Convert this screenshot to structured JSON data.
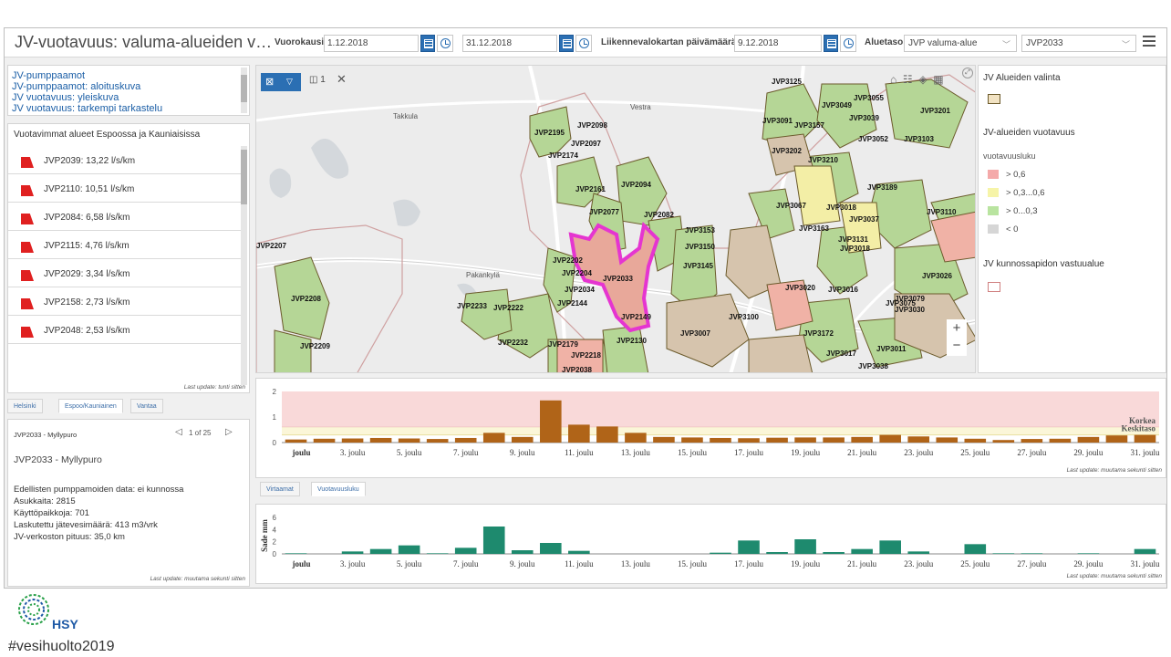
{
  "header": {
    "title": "JV-vuotavuus: valuma-alueiden v…",
    "period_label": "Vuorokausi",
    "start_date": "1.12.2018",
    "end_date": "31.12.2018",
    "trafficmap_label": "Liikennevalokartan päivämäärä",
    "trafficmap_date": "9.12.2018",
    "area_label": "Aluetaso",
    "area_level": "JVP valuma-alue",
    "area_id": "JVP2033"
  },
  "links": [
    "JV-pumppaamot",
    "JV-pumppaamot: aloituskuva",
    "JV vuotavuus: yleiskuva",
    "JV vuotavuus: tarkempi tarkastelu"
  ],
  "ranking": {
    "title": "Vuotavimmat alueet Espoossa ja Kauniaisissa",
    "items": [
      "JVP2039: 13,22 l/s/km",
      "JVP2110: 10,51 l/s/km",
      "JVP2084: 6,58 l/s/km",
      "JVP2115: 4,76 l/s/km",
      "JVP2029: 3,34 l/s/km",
      "JVP2158: 2,73 l/s/km",
      "JVP2048: 2,53 l/s/km"
    ],
    "last_update": "Last update: tunti sitten",
    "tabs": [
      "Helsinki",
      "Espoo/Kauniainen",
      "Vantaa"
    ]
  },
  "details": {
    "selector_label": "JVP2033 - Myllypuro",
    "pager": "1 of 25",
    "heading": "JVP2033 - Myllypuro",
    "lines": [
      "Edellisten pumppamoiden data: ei kunnossa",
      "Asukkaita: 2815",
      "Käyttöpaikkoja: 701",
      "Laskutettu jätevesimäärä: 413 m3/vrk",
      "JV-verkoston pituus: 35,0 km"
    ],
    "last_update": "Last update: muutama sekunti sitten"
  },
  "map": {
    "toolbar_count": "1",
    "places": [
      "Takkula",
      "Vestra",
      "Pakankylä"
    ],
    "area_labels": [
      "JVP3125",
      "JVP3049",
      "JVP3055",
      "JVP3039",
      "JVP3201",
      "JVP3091",
      "JVP3157",
      "JVP3052",
      "JVP3103",
      "JVP3202",
      "JVP3210",
      "JVP3189",
      "JVP3067",
      "JVP3018",
      "JVP3110",
      "JVP3163",
      "JVP3037",
      "JVP3131",
      "JVP3018",
      "JVP3026",
      "JVP3020",
      "JVP3016",
      "JVP3075",
      "JVP3079",
      "JVP3030",
      "JVP3100",
      "JVP3172",
      "JVP3007",
      "JVP3017",
      "JVP3038",
      "JVP3011",
      "JVP2098",
      "JVP2195",
      "JVP2097",
      "JVP2174",
      "JVP2161",
      "JVP2094",
      "JVP2077",
      "JVP2082",
      "JVP3153",
      "JVP3150",
      "JVP3145",
      "JVP2202",
      "JVP2204",
      "JVP2033",
      "JVP2034",
      "JVP2144",
      "JVP2149",
      "JVP2207",
      "JVP2208",
      "JVP2233",
      "JVP2222",
      "JVP2209",
      "JVP2232",
      "JVP2179",
      "JVP2130",
      "JVP2218",
      "JVP2038"
    ]
  },
  "legend": {
    "selection_title": "JV Alueiden valinta",
    "leak_title": "JV-alueiden vuotavuus",
    "variable": "vuotavuusluku",
    "classes": [
      {
        "label": "> 0,6",
        "color": "#f4a9a9"
      },
      {
        "label": "> 0,3...0,6",
        "color": "#f6f4a8"
      },
      {
        "label": "> 0...0,3",
        "color": "#b9e4a0"
      },
      {
        "label": "< 0",
        "color": "#d6d6d6"
      }
    ],
    "maintenance_title": "JV kunnossapidon vastuualue"
  },
  "chart1": {
    "type": "bar",
    "color": "#b06418",
    "band_high_color": "#f9d9d9",
    "band_mid_color": "#fbf6d8",
    "y_ticks": [
      "0",
      "1",
      "2"
    ],
    "ylim": [
      0,
      2
    ],
    "bands": [
      {
        "name": "Korkea",
        "from": 0.6,
        "to": 2
      },
      {
        "name": "Keskitaso",
        "from": 0.3,
        "to": 0.6
      }
    ],
    "categories": [
      "joulu",
      "3. joulu",
      "5. joulu",
      "7. joulu",
      "9. joulu",
      "11. joulu",
      "13. joulu",
      "15. joulu",
      "17. joulu",
      "19. joulu",
      "21. joulu",
      "23. joulu",
      "25. joulu",
      "27. joulu",
      "29. joulu",
      "31. joulu"
    ],
    "values": [
      0.12,
      0.15,
      0.16,
      0.18,
      0.16,
      0.14,
      0.18,
      0.38,
      0.22,
      1.65,
      0.7,
      0.63,
      0.38,
      0.22,
      0.2,
      0.18,
      0.17,
      0.19,
      0.2,
      0.2,
      0.22,
      0.3,
      0.24,
      0.2,
      0.15,
      0.1,
      0.14,
      0.15,
      0.22,
      0.28,
      0.3
    ],
    "last_update": "Last update: muutama sekunti sitten",
    "tabs": [
      "Virtaamat",
      "Vuotavuusluku"
    ]
  },
  "chart2": {
    "type": "bar",
    "color": "#1e8a6e",
    "ylabel": "Sade mm",
    "y_ticks": [
      "0",
      "2",
      "4",
      "6"
    ],
    "ylim": [
      0,
      6
    ],
    "categories": [
      "joulu",
      "3. joulu",
      "5. joulu",
      "7. joulu",
      "9. joulu",
      "11. joulu",
      "13. joulu",
      "15. joulu",
      "17. joulu",
      "19. joulu",
      "21. joulu",
      "23. joulu",
      "25. joulu",
      "27. joulu",
      "29. joulu",
      "31. joulu"
    ],
    "values": [
      0.1,
      0,
      0.4,
      0.8,
      1.4,
      0.1,
      1.0,
      4.5,
      0.6,
      1.8,
      0.5,
      0,
      0,
      0,
      0,
      0.2,
      2.2,
      0.3,
      2.4,
      0.3,
      0.8,
      2.2,
      0.4,
      0,
      1.6,
      0.1,
      0.1,
      0,
      0.1,
      0,
      0.8
    ],
    "last_update": "Last update: muutama sekunti sitten"
  },
  "footer": {
    "logo_text": "HSY",
    "hashtag": "#vesihuolto2019"
  }
}
